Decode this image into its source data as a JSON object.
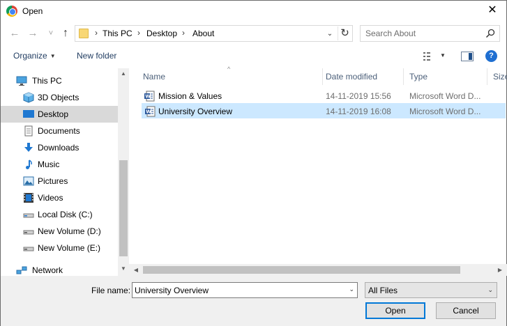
{
  "window": {
    "title": "Open",
    "close_glyph": "✕"
  },
  "navigation": {
    "back_glyph": "←",
    "forward_glyph": "→",
    "recent_glyph": "˅",
    "up_glyph": "↑",
    "breadcrumb": [
      {
        "label": "This PC"
      },
      {
        "label": "Desktop"
      },
      {
        "label": "About"
      }
    ],
    "crumb_separator": "›",
    "dropdown_glyph": "⌄",
    "refresh_glyph": "↻"
  },
  "search": {
    "placeholder": "Search About"
  },
  "toolbar": {
    "organize_label": "Organize",
    "new_folder_label": "New folder",
    "caret": "▼",
    "help_glyph": "?"
  },
  "sidebar": {
    "items": [
      {
        "label": "This PC",
        "icon": "computer-icon",
        "state": "normal"
      },
      {
        "label": "3D Objects",
        "icon": "cube-icon",
        "state": "normal"
      },
      {
        "label": "Desktop",
        "icon": "desktop-icon",
        "state": "selected"
      },
      {
        "label": "Documents",
        "icon": "document-icon",
        "state": "normal"
      },
      {
        "label": "Downloads",
        "icon": "download-icon",
        "state": "normal"
      },
      {
        "label": "Music",
        "icon": "music-icon",
        "state": "normal"
      },
      {
        "label": "Pictures",
        "icon": "picture-icon",
        "state": "normal"
      },
      {
        "label": "Videos",
        "icon": "video-icon",
        "state": "normal"
      },
      {
        "label": "Local Disk (C:)",
        "icon": "drive-icon",
        "state": "normal"
      },
      {
        "label": "New Volume (D:)",
        "icon": "drive-icon",
        "state": "normal"
      },
      {
        "label": "New Volume (E:)",
        "icon": "drive-icon",
        "state": "normal"
      },
      {
        "label": "Network",
        "icon": "network-icon",
        "state": "normal"
      }
    ],
    "scroll_up": "▲",
    "scroll_down": "▼"
  },
  "filelist": {
    "columns": [
      "Name",
      "Date modified",
      "Type",
      "Size"
    ],
    "sort_glyph": "^",
    "rows": [
      {
        "name": "Mission & Values",
        "date": "14-11-2019 15:56",
        "type": "Microsoft Word D...",
        "selected": false
      },
      {
        "name": "University Overview",
        "date": "14-11-2019 16:08",
        "type": "Microsoft Word D...",
        "selected": true
      }
    ],
    "hscroll_left": "◀",
    "hscroll_right": "▶"
  },
  "footer": {
    "file_name_label": "File name:",
    "file_name_value": "University Overview",
    "file_type_value": "All Files",
    "open_label": "Open",
    "cancel_label": "Cancel",
    "dropdown_glyph": "⌄"
  },
  "colors": {
    "selection": "#cce8ff",
    "nav_selected": "#d9d9d9",
    "accent": "#0078d7",
    "word_blue": "#2b579a"
  }
}
